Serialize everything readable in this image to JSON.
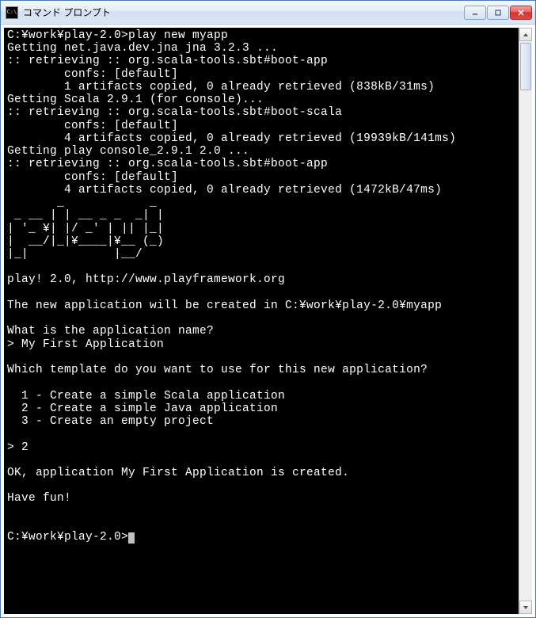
{
  "window": {
    "title": "コマンド プロンプト"
  },
  "console": {
    "text": "C:¥work¥play-2.0>play new myapp\nGetting net.java.dev.jna jna 3.2.3 ...\n:: retrieving :: org.scala-tools.sbt#boot-app\n        confs: [default]\n        1 artifacts copied, 0 already retrieved (838kB/31ms)\nGetting Scala 2.9.1 (for console)...\n:: retrieving :: org.scala-tools.sbt#boot-scala\n        confs: [default]\n        4 artifacts copied, 0 already retrieved (19939kB/141ms)\nGetting play console_2.9.1 2.0 ...\n:: retrieving :: org.scala-tools.sbt#boot-app\n        confs: [default]\n        4 artifacts copied, 0 already retrieved (1472kB/47ms)\n       _            _\n _ __ | | __ _ _  _| |\n| '_ ¥| |/ _' | || |_|\n|  __/|_|¥____|¥__ (_)\n|_|            |__/\n\nplay! 2.0, http://www.playframework.org\n\nThe new application will be created in C:¥work¥play-2.0¥myapp\n\nWhat is the application name?\n> My First Application\n\nWhich template do you want to use for this new application?\n\n  1 - Create a simple Scala application\n  2 - Create a simple Java application\n  3 - Create an empty project\n\n> 2\n\nOK, application My First Application is created.\n\nHave fun!\n\n\nC:¥work¥play-2.0>"
  }
}
